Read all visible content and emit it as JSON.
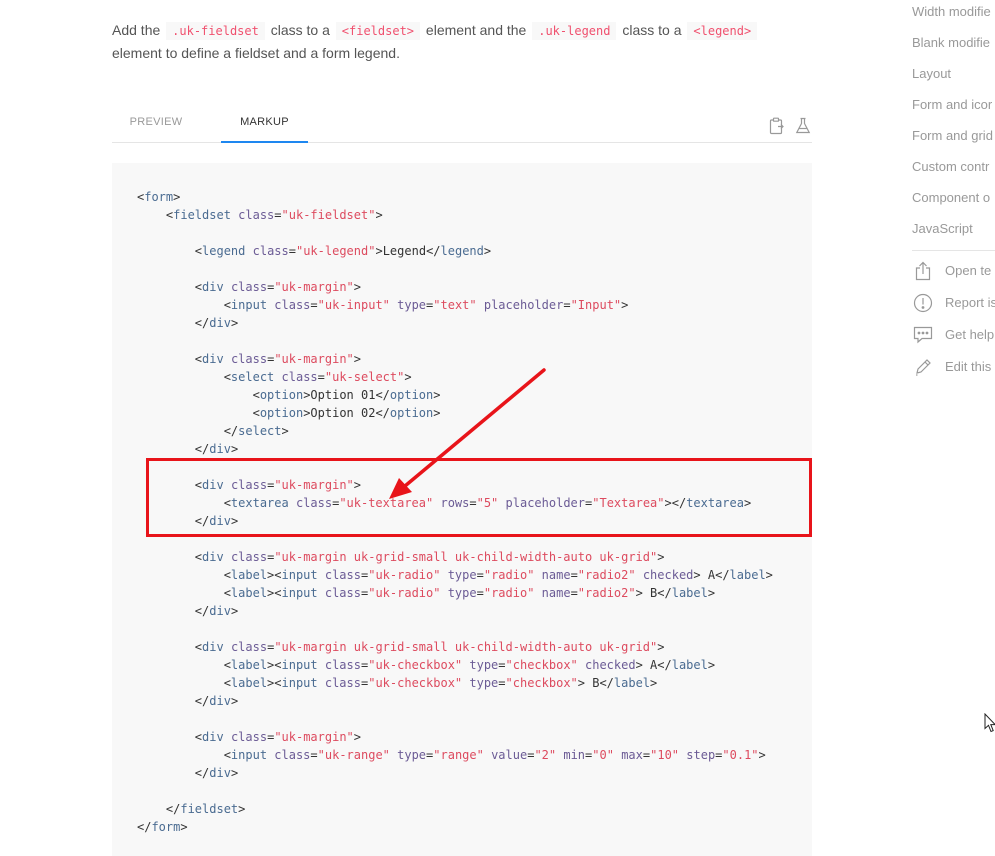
{
  "intro": {
    "text1": "Add the",
    "code1": ".uk-fieldset",
    "text2": "class to a",
    "code2": "<fieldset>",
    "text3": "element and the",
    "code3": ".uk-legend",
    "text4": "class to a",
    "code4": "<legend>",
    "text5": "element to define a fieldset and a form legend."
  },
  "tabs": {
    "preview": "PREVIEW",
    "markup": "MARKUP",
    "active": "MARKUP"
  },
  "toolbar_icons": [
    "clipboard-copy-icon",
    "beaker-icon"
  ],
  "sidebar": {
    "links": [
      "Width modifie",
      "Blank modifie",
      "Layout",
      "Form and icor",
      "Form and grid",
      "Custom contr",
      "Component o",
      "JavaScript"
    ],
    "actions": [
      {
        "icon": "share-icon",
        "label": "Open te"
      },
      {
        "icon": "alert-circle-icon",
        "label": "Report is"
      },
      {
        "icon": "chat-icon",
        "label": "Get help"
      },
      {
        "icon": "pencil-icon",
        "label": "Edit this"
      }
    ]
  },
  "code_tokens": {
    "form": "form",
    "fieldset": "fieldset",
    "legend": "legend",
    "div": "div",
    "input": "input",
    "select": "select",
    "option": "option",
    "textarea": "textarea",
    "label": "label",
    "class": "class",
    "type": "type",
    "placeholder": "placeholder",
    "rows": "rows",
    "name": "name",
    "checked": "checked",
    "value": "value",
    "min": "min",
    "max": "max",
    "step": "step",
    "v_fieldset": "\"uk-fieldset\"",
    "v_legend": "\"uk-legend\"",
    "legend_text": "Legend",
    "v_margin": "\"uk-margin\"",
    "v_input": "\"uk-input\"",
    "v_text": "\"text\"",
    "v_placeholder_input": "\"Input\"",
    "v_select": "\"uk-select\"",
    "option1": "Option 01",
    "option2": "Option 02",
    "v_textarea": "\"uk-textarea\"",
    "v_rows": "\"5\"",
    "v_placeholder_textarea": "\"Textarea\"",
    "v_grid": "\"uk-margin uk-grid-small uk-child-width-auto uk-grid\"",
    "v_radio": "\"uk-radio\"",
    "v_type_radio": "\"radio\"",
    "v_radio2": "\"radio2\"",
    "label_a": " A",
    "label_b": " B",
    "v_checkbox": "\"uk-checkbox\"",
    "v_type_checkbox": "\"checkbox\"",
    "v_range": "\"uk-range\"",
    "v_type_range": "\"range\"",
    "v_value": "\"2\"",
    "v_min": "\"0\"",
    "v_max": "\"10\"",
    "v_step": "\"0.1\""
  },
  "colors": {
    "accent": "#1e87f0",
    "annotation": "#e8141a",
    "code_bg": "#f8f8f8",
    "inline_code": "#f0506e"
  }
}
